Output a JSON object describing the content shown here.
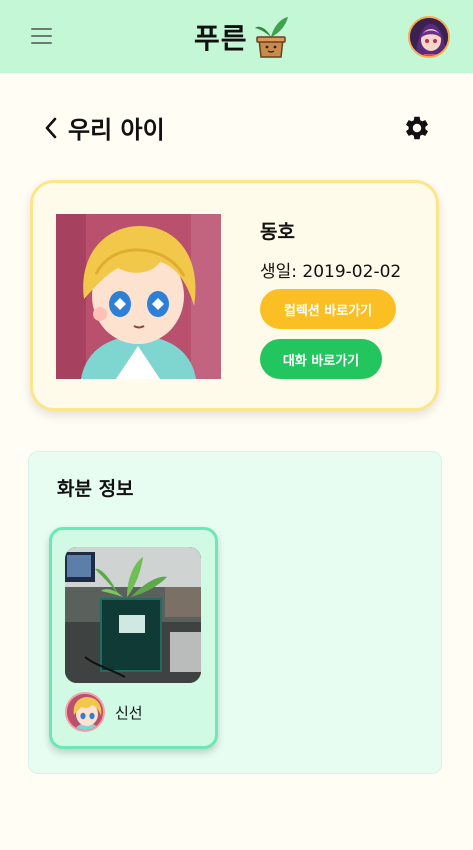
{
  "header": {
    "logo_text": "푸른",
    "menu_icon": "hamburger-icon",
    "profile_icon": "avatar"
  },
  "page": {
    "title": "우리 아이",
    "back_icon": "chevron-left-icon",
    "settings_icon": "gear-icon"
  },
  "child": {
    "name": "동호",
    "birth": "생일: 2019-02-02",
    "collection_button": "컬렉션 바로가기",
    "chat_button": "대화 바로가기"
  },
  "pot_info": {
    "title": "화분 정보",
    "pots": [
      {
        "name": "신선"
      }
    ]
  },
  "colors": {
    "header_bg": "#c3f7d5",
    "page_bg": "#fffdf4",
    "card_bg": "#fffbea",
    "card_border": "#fde68a",
    "collection_btn": "#fbbf24",
    "chat_btn": "#22c55e",
    "pot_section_bg": "#e8fdf1",
    "pot_card_bg": "#d1fae5",
    "pot_card_border": "#6ee7b7"
  }
}
